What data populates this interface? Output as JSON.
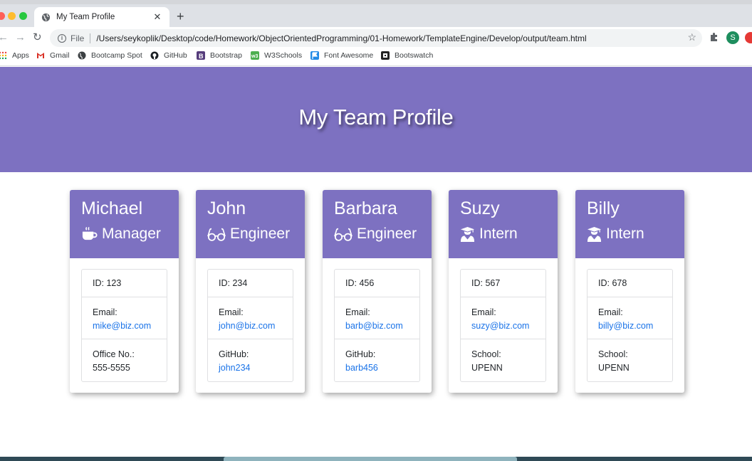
{
  "browser": {
    "tab_title": "My Team Profile",
    "tab_close": "✕",
    "new_tab": "+",
    "url_scheme": "File",
    "url": "/Users/seykoplik/Desktop/code/Homework/ObjectOrientedProgramming/01-Homework/TemplateEngine/Develop/output/team.html",
    "profile_initial": "S",
    "bookmarks": [
      {
        "label": "Apps",
        "icon": "apps-grid-icon"
      },
      {
        "label": "Gmail",
        "icon": "gmail-icon"
      },
      {
        "label": "Bootcamp Spot",
        "icon": "globe-icon"
      },
      {
        "label": "GitHub",
        "icon": "github-icon"
      },
      {
        "label": "Bootstrap",
        "icon": "bootstrap-icon"
      },
      {
        "label": "W3Schools",
        "icon": "w3schools-icon"
      },
      {
        "label": "Font Awesome",
        "icon": "font-awesome-flag-icon"
      },
      {
        "label": "Bootswatch",
        "icon": "bootswatch-icon"
      }
    ]
  },
  "page": {
    "title": "My Team Profile",
    "accent_color": "#7d71c1"
  },
  "team": [
    {
      "name": "Michael",
      "role": "Manager",
      "role_icon": "coffee-mug-icon",
      "id": "ID: 123",
      "email_label": "Email:",
      "email": "mike@biz.com",
      "extra_label": "Office No.:",
      "extra_value": "555-5555",
      "extra_is_link": false
    },
    {
      "name": "John",
      "role": "Engineer",
      "role_icon": "glasses-icon",
      "id": "ID: 234",
      "email_label": "Email:",
      "email": "john@biz.com",
      "extra_label": "GitHub:",
      "extra_value": "john234",
      "extra_is_link": true
    },
    {
      "name": "Barbara",
      "role": "Engineer",
      "role_icon": "glasses-icon",
      "id": "ID: 456",
      "email_label": "Email:",
      "email": "barb@biz.com",
      "extra_label": "GitHub:",
      "extra_value": "barb456",
      "extra_is_link": true
    },
    {
      "name": "Suzy",
      "role": "Intern",
      "role_icon": "graduate-icon",
      "id": "ID: 567",
      "email_label": "Email:",
      "email": "suzy@biz.com",
      "extra_label": "School:",
      "extra_value": "UPENN",
      "extra_is_link": false
    },
    {
      "name": "Billy",
      "role": "Intern",
      "role_icon": "graduate-icon",
      "id": "ID: 678",
      "email_label": "Email:",
      "email": "billy@biz.com",
      "extra_label": "School:",
      "extra_value": "UPENN",
      "extra_is_link": false
    }
  ]
}
